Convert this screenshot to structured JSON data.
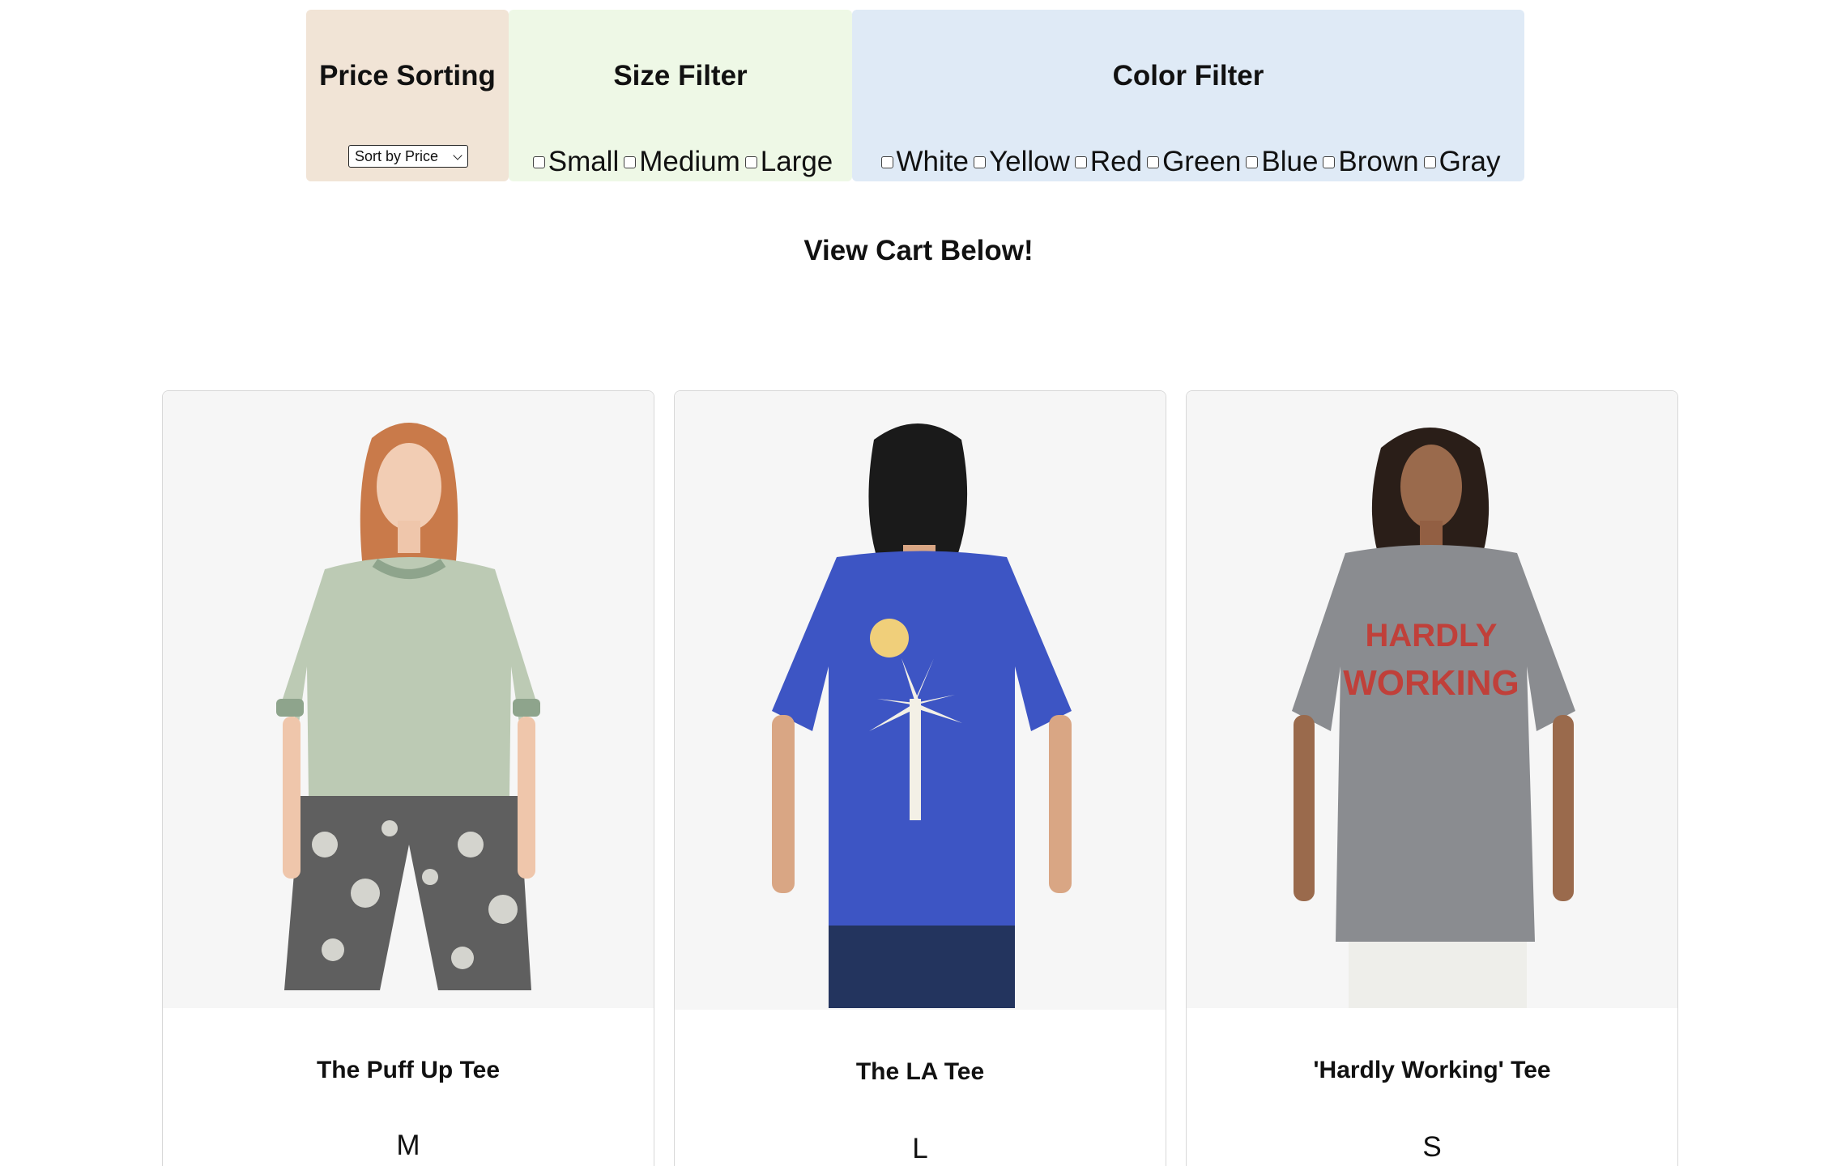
{
  "filters": {
    "price": {
      "title": "Price Sorting",
      "select_value": "Sort by Price"
    },
    "size": {
      "title": "Size Filter",
      "options": [
        "Small",
        "Medium",
        "Large"
      ]
    },
    "color": {
      "title": "Color Filter",
      "options": [
        "White",
        "Yellow",
        "Red",
        "Green",
        "Blue",
        "Brown",
        "Gray"
      ]
    }
  },
  "cart_heading": "View Cart Below!",
  "products": [
    {
      "name": "The Puff Up Tee",
      "size": "M",
      "shirt_color": "#bccab4",
      "trim_color": "#8ea48c"
    },
    {
      "name": "The LA Tee",
      "size": "L",
      "shirt_color": "#3d55c4",
      "print_text": ""
    },
    {
      "name": "'Hardly Working' Tee",
      "size": "S",
      "shirt_color": "#8a8c90",
      "print_color": "#c0403a",
      "print_text": "HARDLY WORKING"
    }
  ]
}
